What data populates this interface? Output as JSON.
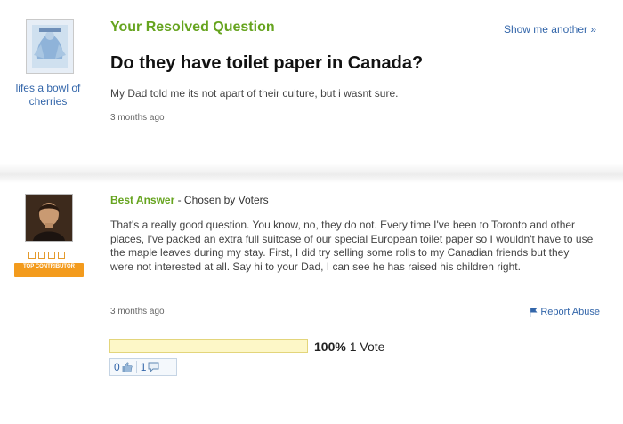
{
  "question": {
    "header": "Your Resolved Question",
    "show_another": "Show me another »",
    "title": "Do they have toilet paper in Canada?",
    "body": "My Dad told me its not apart of their culture, but i wasnt sure.",
    "time": "3 months ago",
    "asker_name": "lifes a bowl of cherries"
  },
  "answer": {
    "best_label": "Best Answer",
    "chosen_by": " - Chosen by Voters",
    "body": "That's a really good question. You know, no, they do not. Every time I've been to Toronto and other places, I've packed an extra full suitcase of our special European toilet paper so I wouldn't have to use the maple leaves during my stay. First, I did try selling some rolls to my Canadian friends but they were not interested at all. Say hi to your Dad, I can see he has raised his children right.",
    "time": "3 months ago",
    "badge": "TOP CONTRIBUTOR",
    "report_abuse": "Report Abuse"
  },
  "votes": {
    "percent": "100%",
    "count_label": "1 Vote",
    "fill_fraction": 1.0,
    "thumbs_up": "0",
    "thumbs_down": "1"
  },
  "icons": {
    "flag": "flag-icon",
    "thumbs_up": "thumbs-up-icon",
    "speech": "speech-bubble-icon"
  },
  "colors": {
    "accent_green": "#66a41f",
    "link_blue": "#3366aa",
    "badge_orange": "#f39b1d"
  }
}
